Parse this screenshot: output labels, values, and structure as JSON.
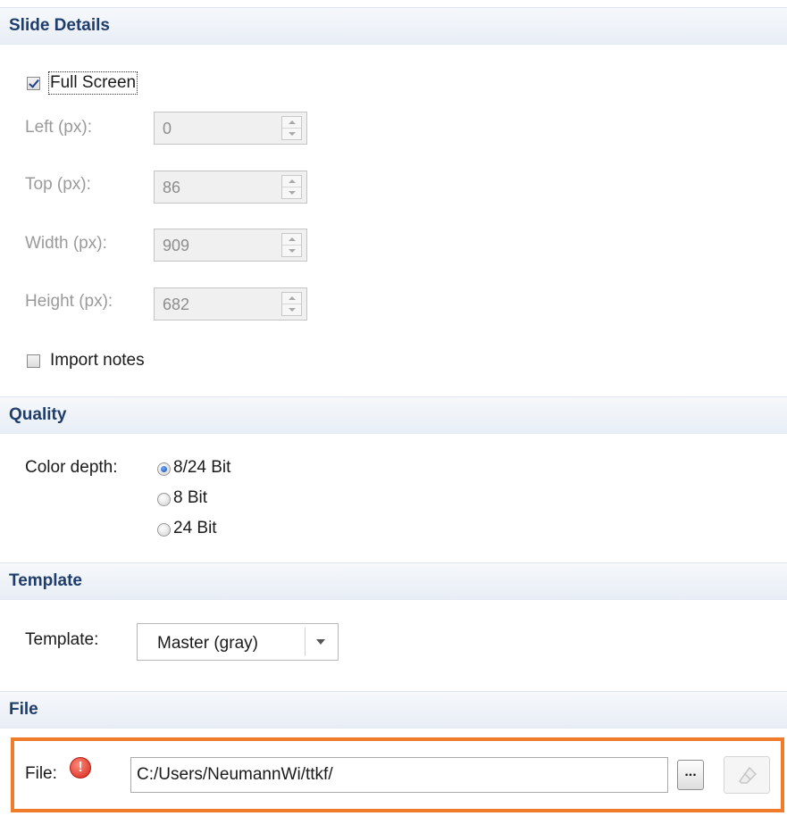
{
  "slide_details": {
    "header": "Slide Details",
    "full_screen_label": "Full Screen",
    "full_screen_checked": true,
    "fields": [
      {
        "label": "Left (px):",
        "value": "0"
      },
      {
        "label": "Top (px):",
        "value": "86"
      },
      {
        "label": "Width (px):",
        "value": "909"
      },
      {
        "label": "Height (px):",
        "value": "682"
      }
    ],
    "import_notes_label": "Import notes",
    "import_notes_checked": false
  },
  "quality": {
    "header": "Quality",
    "color_depth_label": "Color depth:",
    "options": [
      "8/24 Bit",
      "8 Bit",
      "24 Bit"
    ],
    "selected": "8/24 Bit"
  },
  "template": {
    "header": "Template",
    "label": "Template:",
    "selected": "Master (gray)"
  },
  "file": {
    "header": "File",
    "label": "File:",
    "path": "C:/Users/NeumannWi/ttkf/",
    "browse_label": "...",
    "highlight_color": "#f07b2a",
    "error_icon": "error-icon"
  }
}
